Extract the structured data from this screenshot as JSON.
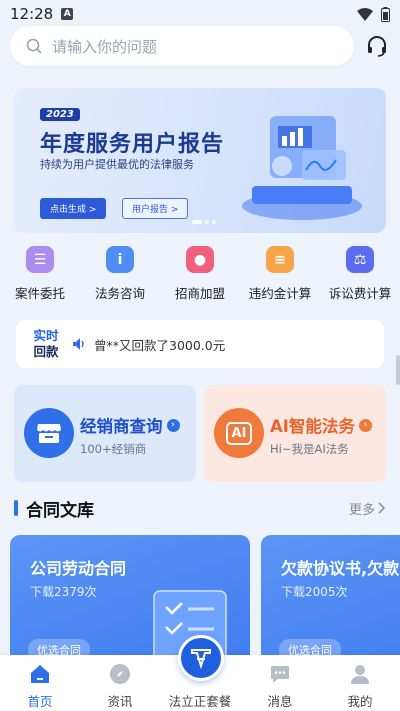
{
  "status_bar": {
    "time": "12:28",
    "notif_badge": "A"
  },
  "search": {
    "placeholder": "请输入你的问题"
  },
  "banner": {
    "year": "2023",
    "title": "年度服务用户报告",
    "subtitle": "持续为用户提供最优的法律服务",
    "primary_button": "点击生成 >",
    "secondary_button": "用户报告 >"
  },
  "shortcuts": [
    {
      "label": "案件委托",
      "icon": "case-icon",
      "color": "#a98ef0"
    },
    {
      "label": "法务咨询",
      "icon": "consult-icon",
      "color": "#4f8ef5"
    },
    {
      "label": "招商加盟",
      "icon": "join-icon",
      "color": "#f0607e"
    },
    {
      "label": "违约金计算",
      "icon": "calculator-icon",
      "color": "#f5a44a"
    },
    {
      "label": "诉讼费计算",
      "icon": "gavel-icon",
      "color": "#5b6cf0"
    }
  ],
  "realtime": {
    "tag_line1": "实时",
    "tag_line2": "回款",
    "message": "曾**又回款了3000.0元"
  },
  "features": [
    {
      "title": "经销商查询",
      "desc": "100+经销商",
      "icon": "store-icon"
    },
    {
      "title": "AI智能法务",
      "desc": "Hi~我是AI法务",
      "icon": "ai-icon",
      "icon_text": "AI"
    }
  ],
  "contracts_section": {
    "title": "合同文库",
    "more": "更多",
    "items": [
      {
        "title": "公司劳动合同",
        "downloads": "下载2379次",
        "badge": "优选合同"
      },
      {
        "title": "欠款协议书,欠款",
        "downloads": "下载2005次",
        "badge": "优选合同"
      }
    ]
  },
  "tabbar": {
    "items": [
      {
        "label": "首页",
        "icon": "home-icon",
        "active": true
      },
      {
        "label": "资讯",
        "icon": "compass-icon",
        "active": false
      },
      {
        "label": "法立正套餐",
        "icon": "package-icon",
        "active": false
      },
      {
        "label": "消息",
        "icon": "message-icon",
        "active": false
      },
      {
        "label": "我的",
        "icon": "profile-icon",
        "active": false
      }
    ]
  },
  "colors": {
    "accent": "#2f6fe8",
    "orange": "#f07a3c",
    "background": "#eef3fb"
  }
}
